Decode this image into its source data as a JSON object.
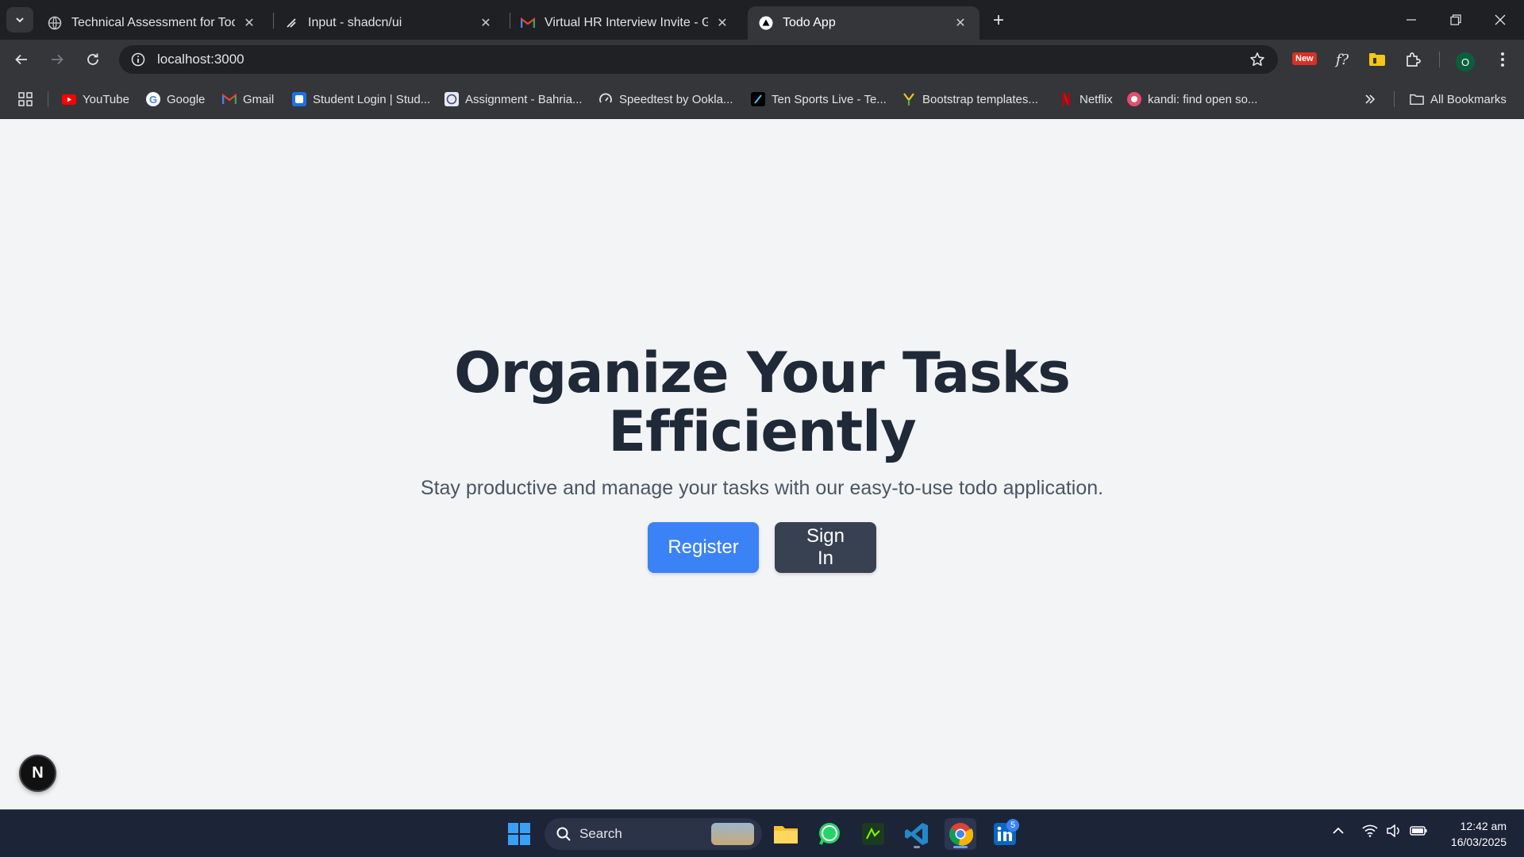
{
  "browser": {
    "tabs": [
      {
        "title": "Technical Assessment for Todo \\",
        "favicon": "globe-icon",
        "active": false
      },
      {
        "title": "Input - shadcn/ui",
        "favicon": "shadcn-icon",
        "active": false
      },
      {
        "title": "Virtual HR Interview Invite - Go",
        "favicon": "gmail-icon",
        "active": false
      },
      {
        "title": "Todo App",
        "favicon": "triangle-icon",
        "active": true
      }
    ],
    "address": "localhost:3000",
    "new_badge": "New",
    "profile_initial": "O",
    "bookmarks": [
      {
        "label": "YouTube",
        "icon": "youtube-icon"
      },
      {
        "label": "Google",
        "icon": "google-icon"
      },
      {
        "label": "Gmail",
        "icon": "gmail-icon"
      },
      {
        "label": "Student Login | Stud...",
        "icon": "student-icon"
      },
      {
        "label": "Assignment - Bahria...",
        "icon": "assignment-icon"
      },
      {
        "label": "Speedtest by Ookla...",
        "icon": "speedtest-icon"
      },
      {
        "label": "Ten Sports Live - Te...",
        "icon": "tensports-icon"
      },
      {
        "label": "Bootstrap templates...",
        "icon": "bootstrap-icon"
      },
      {
        "label": "Netflix",
        "icon": "netflix-icon"
      },
      {
        "label": "kandi: find open so...",
        "icon": "kandi-icon"
      }
    ],
    "all_bookmarks": "All Bookmarks"
  },
  "hero": {
    "title_line1": "Organize Your Tasks",
    "title_line2": "Efficiently",
    "subtitle": "Stay productive and manage your tasks with our easy-to-use todo application.",
    "register_label": "Register",
    "signin_label": "Sign In"
  },
  "dev_indicator": "N",
  "taskbar": {
    "search_label": "Search",
    "linkedin_badge": "5",
    "time": "12:42 am",
    "date": "16/03/2025"
  },
  "colors": {
    "primary": "#3b82f6",
    "secondary": "#374151",
    "heading": "#1f2937",
    "page_bg": "#f3f4f6"
  }
}
